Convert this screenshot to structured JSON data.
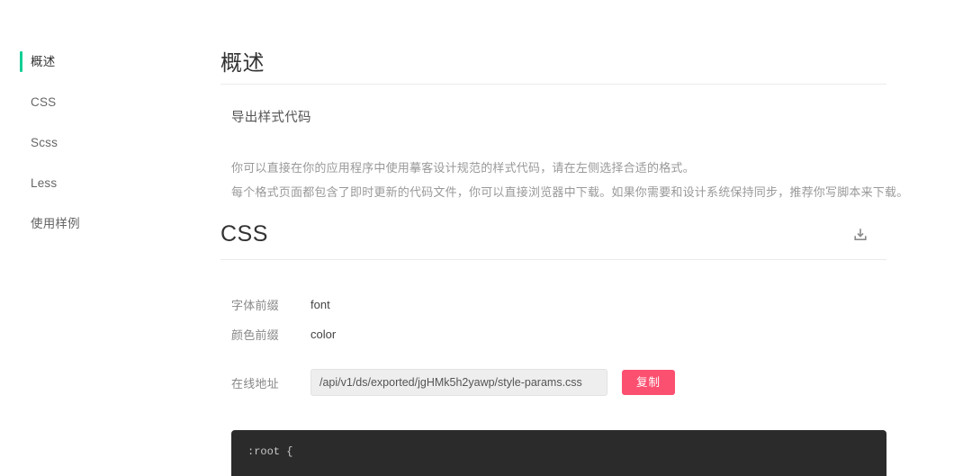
{
  "sidebar": {
    "items": [
      {
        "label": "概述",
        "active": true
      },
      {
        "label": "CSS",
        "active": false
      },
      {
        "label": "Scss",
        "active": false
      },
      {
        "label": "Less",
        "active": false
      },
      {
        "label": "使用样例",
        "active": false
      }
    ],
    "accent_color": "#13ce94"
  },
  "main": {
    "page_title": "概述",
    "subsection_title": "导出样式代码",
    "paragraphs": [
      "你可以直接在你的应用程序中使用摹客设计规范的样式代码，请在左侧选择合适的格式。",
      "每个格式页面都包含了即时更新的代码文件，你可以直接浏览器中下载。如果你需要和设计系统保持同步，推荐你写脚本来下载。"
    ],
    "section": {
      "title": "CSS",
      "download_icon": "download-icon"
    },
    "fields": [
      {
        "label": "字体前缀",
        "value": "font"
      },
      {
        "label": "颜色前缀",
        "value": "color"
      }
    ],
    "url_field": {
      "label": "在线地址",
      "value": "/api/v1/ds/exported/jgHMk5h2yawp/style-params.css",
      "placeholder": "",
      "copy_label": "复制",
      "copy_color": "#fc5070"
    },
    "code": {
      "lines": [
        ":root {"
      ],
      "background": "#2b2b2b",
      "text_color": "#c9c9c9"
    }
  }
}
